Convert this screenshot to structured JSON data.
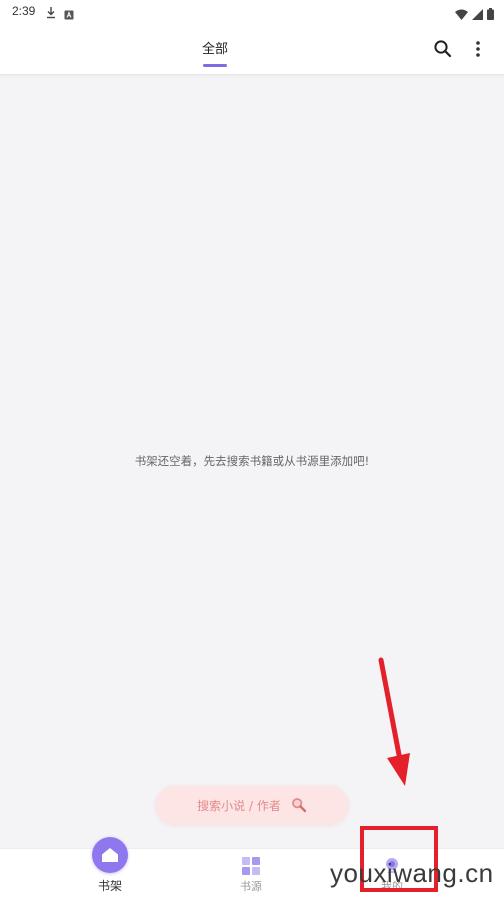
{
  "status_bar": {
    "time": "2:39"
  },
  "app_bar": {
    "tab_label": "全部",
    "search_icon": "search-icon",
    "more_icon": "more-vert-icon"
  },
  "main": {
    "empty_message": "书架还空着，先去搜索书籍或从书源里添加吧!"
  },
  "fab": {
    "label": "搜索小说 / 作者",
    "icon": "magnifier-icon"
  },
  "bottom_nav": {
    "items": [
      {
        "label": "书架",
        "icon": "home-icon",
        "active": true
      },
      {
        "label": "书源",
        "icon": "grid-icon",
        "active": false
      },
      {
        "label": "我的",
        "icon": "profile-icon",
        "active": false
      }
    ]
  },
  "colors": {
    "accent": "#8f78ee",
    "tab_indicator": "#7e6be4",
    "pill_bg": "#fde5e5",
    "pill_text": "#e08b8b",
    "annotation_red": "#e4202a"
  },
  "watermark": {
    "text": "youxiwang.cn"
  }
}
